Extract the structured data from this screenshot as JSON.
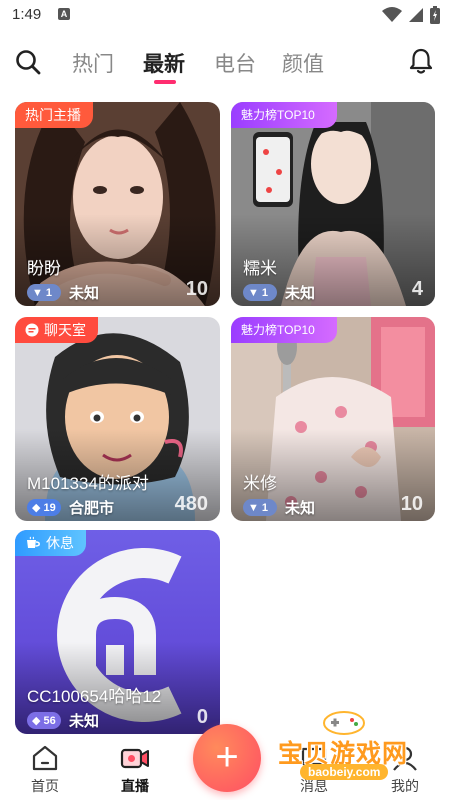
{
  "status_bar": {
    "time": "1:49",
    "notif_letter": "A"
  },
  "top_nav": {
    "tabs": [
      {
        "label": "热门",
        "active": false
      },
      {
        "label": "最新",
        "active": true
      },
      {
        "label": "电台",
        "active": false
      },
      {
        "label": "颜值",
        "active": false
      }
    ],
    "accent": "#ff2d6f"
  },
  "cards": [
    {
      "tag": "热门主播",
      "tag_style": "hot",
      "name": "盼盼",
      "level": "1",
      "location": "未知",
      "count": "10"
    },
    {
      "tag": "魅力榜TOP10",
      "tag_style": "charm",
      "name": "糯米",
      "level": "1",
      "location": "未知",
      "count": "4"
    },
    {
      "tag": "聊天室",
      "tag_style": "chat",
      "name": "M101334的派对",
      "level": "19",
      "location": "合肥市",
      "count": "480"
    },
    {
      "tag": "魅力榜TOP10",
      "tag_style": "charm",
      "name": "米修",
      "level": "1",
      "location": "未知",
      "count": "10"
    },
    {
      "tag": "休息",
      "tag_style": "rest",
      "name": "CC100654哈哈12",
      "level": "56",
      "location": "未知",
      "count": "0"
    }
  ],
  "bottom_nav": {
    "items": [
      {
        "label": "首页",
        "icon": "home-icon",
        "active": false
      },
      {
        "label": "直播",
        "icon": "live-camera-icon",
        "active": true
      },
      {
        "label": "消息",
        "icon": "message-icon",
        "active": false
      },
      {
        "label": "我的",
        "icon": "profile-icon",
        "active": false
      }
    ],
    "fab_symbol": "+"
  },
  "watermark": {
    "title": "宝贝游戏网",
    "url": "baobeiy.com"
  }
}
